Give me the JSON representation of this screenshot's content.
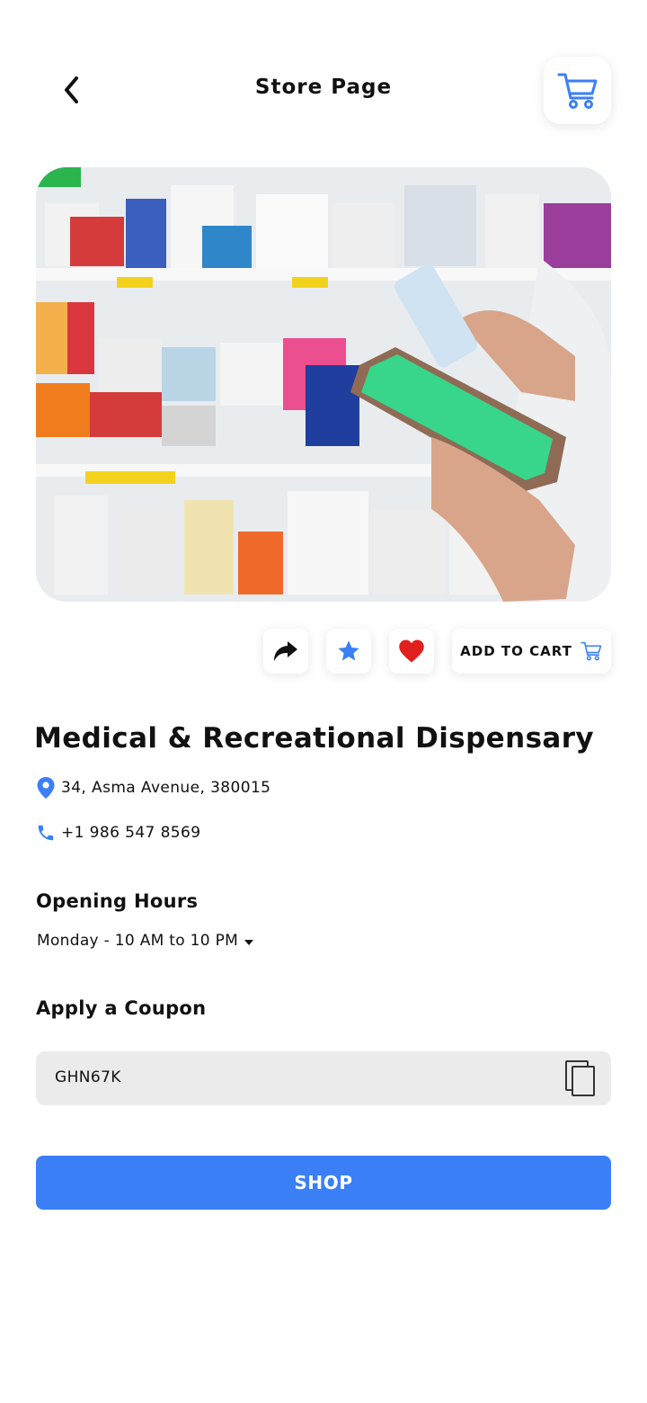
{
  "header": {
    "title": "Store Page",
    "back_icon": "chevron-left-icon",
    "cart_icon": "cart-icon"
  },
  "hero": {
    "image": "pharmacy-shelves-photo",
    "icon": "photo"
  },
  "actions": {
    "share_icon": "share-icon",
    "star_icon": "star-icon",
    "heart_icon": "heart-icon",
    "add_to_cart_label": "ADD TO CART",
    "add_to_cart_icon": "cart-icon"
  },
  "store": {
    "name": "Medical & Recreational Dispensary",
    "address": "34, Asma Avenue, 380015",
    "phone": "+1 986 547 8569"
  },
  "hours": {
    "title": "Opening Hours",
    "selected": "Monday - 10 AM to 10 PM"
  },
  "coupon": {
    "title": "Apply a Coupon",
    "code": "GHN67K",
    "copy_icon": "copy-icon"
  },
  "shop_button": {
    "label": "SHOP"
  },
  "colors": {
    "accent": "#3a7ff6",
    "heart": "#e0201e",
    "coupon_bg": "#ebebeb"
  }
}
